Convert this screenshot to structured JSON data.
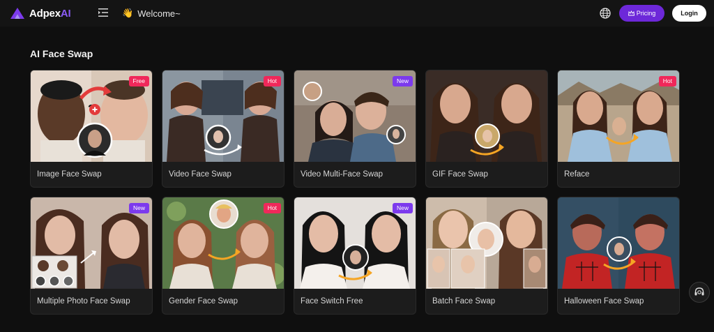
{
  "header": {
    "brand_name": "Adpex",
    "brand_suffix": "AI",
    "welcome_text": "Welcome~",
    "pricing_label": "Pricing",
    "login_label": "Login"
  },
  "section": {
    "title": "AI Face Swap"
  },
  "cards": [
    {
      "label": "Image Face Swap",
      "badge": "Free"
    },
    {
      "label": "Video Face Swap",
      "badge": "Hot"
    },
    {
      "label": "Video Multi-Face Swap",
      "badge": "New"
    },
    {
      "label": "GIF Face Swap",
      "badge": ""
    },
    {
      "label": "Reface",
      "badge": "Hot"
    },
    {
      "label": "Multiple Photo Face Swap",
      "badge": "New"
    },
    {
      "label": "Gender Face Swap",
      "badge": "Hot"
    },
    {
      "label": "Face Switch Free",
      "badge": "New"
    },
    {
      "label": "Batch Face Swap",
      "badge": ""
    },
    {
      "label": "Halloween Face Swap",
      "badge": ""
    }
  ],
  "colors": {
    "accent": "#6d28d9",
    "hot_badge": "#f0285a",
    "new_badge": "#7c3aed",
    "background": "#0f0f0f"
  }
}
